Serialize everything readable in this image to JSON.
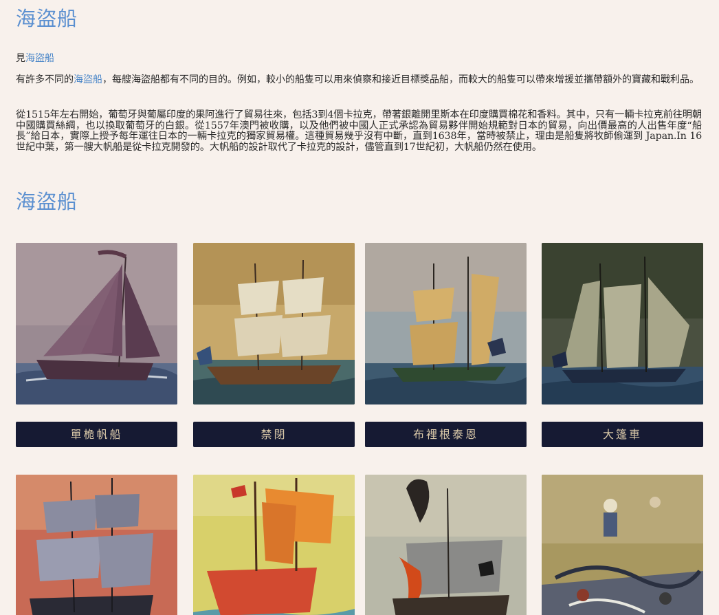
{
  "page": {
    "title": "海盜船",
    "see_prefix": "見",
    "see_link": "海盜船",
    "para1_prefix": "有許多不同的",
    "para1_link": "海盜船",
    "para1_rest": "，每艘海盜船都有不同的目的。例如，較小的船隻可以用來偵察和接近目標獎品船，而較大的船隻可以帶來增援並攜帶額外的寶藏和戰利品。",
    "para2": "從1515年左右開始，葡萄牙與葡屬印度的果阿進行了貿易往來，包括3到4個卡拉克，帶著銀離開里斯本在印度購買棉花和香料。其中，只有一輛卡拉克前往明朝中國購買絲綢，也以換取葡萄牙的白銀。從1557年澳門被收購，以及他們被中國人正式承認為貿易夥伴開始規範對日本的貿易，向出價最高的人出售年度“船長”給日本，實際上授予每年運往日本的一輛卡拉克的獨家貿易權。這種貿易幾乎沒有中斷，直到1638年，當時被禁止，理由是船隻將牧師偷運到 Japan.In 16世紀中葉，第一艘大帆船是從卡拉克開發的。大帆船的設計取代了卡拉克的設計，儘管直到17世紀初，大帆船仍然在使用。",
    "section_title": "海盜船"
  },
  "gallery": [
    {
      "caption": "單桅帆船"
    },
    {
      "caption": "禁閉"
    },
    {
      "caption": "布裡根泰恩"
    },
    {
      "caption": "大篷車"
    },
    {
      "caption": ""
    },
    {
      "caption": ""
    },
    {
      "caption": ""
    },
    {
      "caption": ""
    }
  ],
  "colors": {
    "accent": "#5a8fd0",
    "link": "#4a86c8",
    "caption_bg": "#161a33",
    "caption_text": "#d9c8a8",
    "page_bg": "#f8f1ec"
  }
}
